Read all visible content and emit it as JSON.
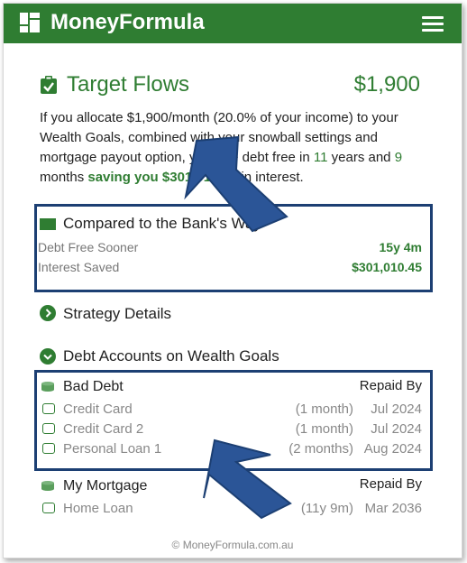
{
  "header": {
    "brand": "MoneyFormula",
    "accent": "#2f7d32"
  },
  "target": {
    "title": "Target Flows",
    "amount": "$1,900",
    "desc_a": "If you allocate $1,900/month (20.0% of your income) to your Wealth Goals, combined with your snowball settings and mortgage payout option, you'll be debt free in ",
    "years": "11",
    "desc_b": " years and ",
    "months": "9",
    "desc_c": " months ",
    "saving": "saving you $301,010.45",
    "desc_d": " in interest."
  },
  "compare": {
    "title": "Compared to the Bank's Way",
    "rows": [
      {
        "label": "Debt Free Sooner",
        "value": "15y 4m"
      },
      {
        "label": "Interest Saved",
        "value": "$301,010.45"
      }
    ]
  },
  "sections": {
    "strategy": "Strategy Details",
    "debt_accounts": "Debt Accounts on Wealth Goals"
  },
  "bad_debt": {
    "title": "Bad Debt",
    "repaid_label": "Repaid By",
    "accounts": [
      {
        "name": "Credit Card",
        "duration": "(1 month)",
        "date": "Jul 2024"
      },
      {
        "name": "Credit Card 2",
        "duration": "(1 month)",
        "date": "Jul 2024"
      },
      {
        "name": "Personal Loan 1",
        "duration": "(2 months)",
        "date": "Aug 2024"
      }
    ]
  },
  "mortgage": {
    "title": "My Mortgage",
    "repaid_label": "Repaid By",
    "accounts": [
      {
        "name": "Home Loan",
        "duration": "(11y 9m)",
        "date": "Mar 2036"
      }
    ]
  },
  "footer": "© MoneyFormula.com.au"
}
